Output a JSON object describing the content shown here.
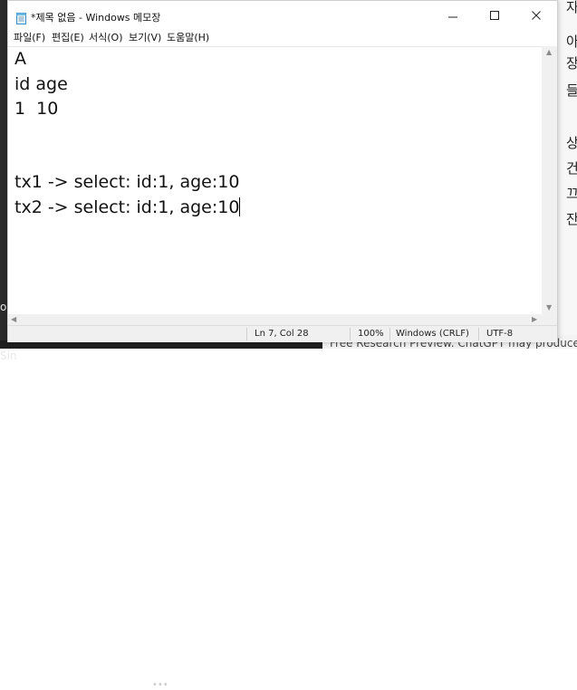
{
  "window": {
    "title": "*제목 없음 - Windows 메모장"
  },
  "menu": [
    "파일(F)",
    "편집(E)",
    "서식(O)",
    "보기(V)",
    "도움말(H)"
  ],
  "editor": {
    "lines": [
      "A",
      "id age",
      "1  10",
      "",
      "",
      "tx1 -> select: id:1, age:10",
      "tx2 -> select: id:1, age:10"
    ]
  },
  "status": {
    "position": "Ln 7, Col 28",
    "zoom": "100%",
    "line_ending": "Windows (CRLF)",
    "encoding": "UTF-8"
  },
  "background": {
    "left_labels": [
      "og",
      "n Sin"
    ],
    "right_chars": [
      "자",
      "아",
      "장",
      "들",
      "상",
      "건",
      "끄",
      "잔"
    ],
    "footer": "Free Research Preview. ChatGPT may produce in",
    "dots": "•••"
  }
}
